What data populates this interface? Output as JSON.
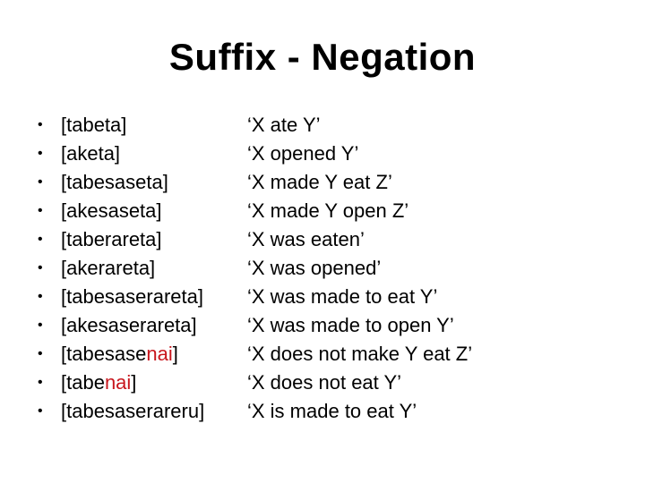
{
  "slide": {
    "title": "Suffix - Negation",
    "accent_color": "#c8161d",
    "items": [
      {
        "form_plain": "[tabeta]",
        "form_highlight": "",
        "form_close": "",
        "gloss": "‘X ate Y’"
      },
      {
        "form_plain": "[aketa]",
        "form_highlight": "",
        "form_close": "",
        "gloss": "‘X opened Y’"
      },
      {
        "form_plain": "[tabesaseta]",
        "form_highlight": "",
        "form_close": "",
        "gloss": "‘X made Y eat Z’"
      },
      {
        "form_plain": "[akesaseta]",
        "form_highlight": "",
        "form_close": "",
        "gloss": "‘X made Y open Z’"
      },
      {
        "form_plain": "[taberareta]",
        "form_highlight": "",
        "form_close": "",
        "gloss": "‘X was eaten’"
      },
      {
        "form_plain": "[akerareta]",
        "form_highlight": "",
        "form_close": "",
        "gloss": "‘X was opened’"
      },
      {
        "form_plain": "[tabesaserareta]",
        "form_highlight": "",
        "form_close": "",
        "gloss": "‘X was made to eat Y’"
      },
      {
        "form_plain": "[akesaserareta]",
        "form_highlight": "",
        "form_close": "",
        "gloss": "‘X was made to open Y’"
      },
      {
        "form_plain": "[tabesase",
        "form_highlight": "nai",
        "form_close": "]",
        "gloss": "‘X does not make Y eat Z’"
      },
      {
        "form_plain": "[tabe",
        "form_highlight": "nai",
        "form_close": "]",
        "gloss": "‘X does not eat Y’"
      },
      {
        "form_plain": "[tabesaserareru]",
        "form_highlight": "",
        "form_close": "",
        "gloss": "‘X is made to eat Y’"
      }
    ],
    "bullet_glyph": "•"
  }
}
